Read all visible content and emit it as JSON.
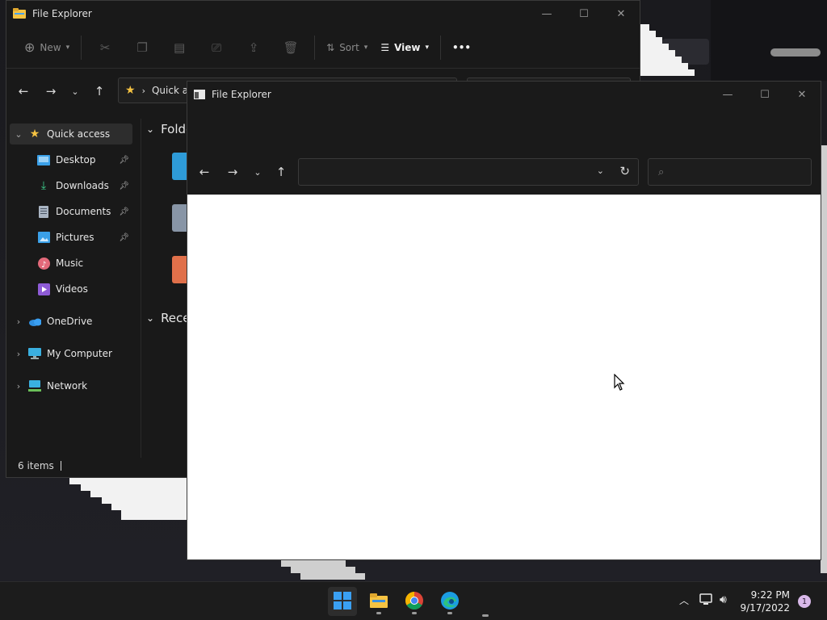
{
  "back_window": {
    "title": "File Explorer",
    "toolbar": {
      "new_label": "New",
      "sort_label": "Sort",
      "view_label": "View",
      "more_label": "•••"
    },
    "address_text": "Quick a",
    "sidebar": {
      "items": [
        {
          "label": "Quick access",
          "icon": "star-icon"
        },
        {
          "label": "Desktop",
          "icon": "desktop-icon"
        },
        {
          "label": "Downloads",
          "icon": "download-icon"
        },
        {
          "label": "Documents",
          "icon": "document-icon"
        },
        {
          "label": "Pictures",
          "icon": "pictures-icon"
        },
        {
          "label": "Music",
          "icon": "music-icon"
        },
        {
          "label": "Videos",
          "icon": "videos-icon"
        },
        {
          "label": "OneDrive",
          "icon": "cloud-icon"
        },
        {
          "label": "My Computer",
          "icon": "computer-icon"
        },
        {
          "label": "Network",
          "icon": "network-icon"
        }
      ]
    },
    "content": {
      "folders_heading": "Folder",
      "recent_heading": "Recent"
    },
    "status": "6 items"
  },
  "front_window": {
    "title": "File Explorer"
  },
  "taskbar": {
    "apps": [
      "start-icon",
      "file-explorer-icon",
      "chrome-icon",
      "edge-icon"
    ],
    "time": "9:22 PM",
    "date": "9/17/2022",
    "notifications": "1"
  },
  "colors": {
    "accent_folder": "#f6c342",
    "start_blue": "#3aa0f3",
    "notif_badge": "#d8b8e8"
  }
}
